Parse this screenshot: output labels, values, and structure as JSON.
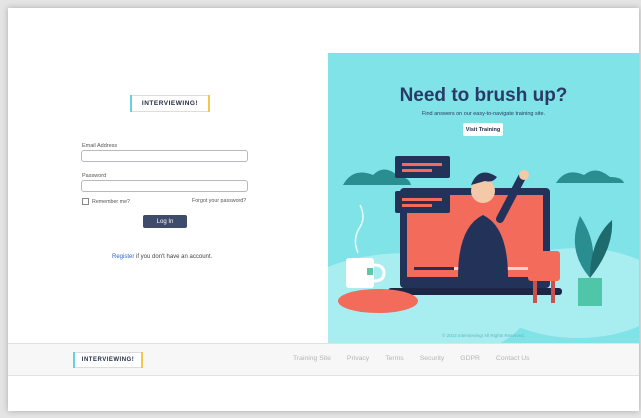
{
  "login": {
    "logo_text": "INTERVIEWING!",
    "email_label": "Email Address",
    "email_value": "",
    "password_label": "Password",
    "password_value": "",
    "remember_label": "Remember me?",
    "forgot_label": "Forgot your password?",
    "login_button": "Log In",
    "register_link": "Register",
    "register_text": " if you don't have an account."
  },
  "promo": {
    "title": "Need to brush up?",
    "subtitle": "Find answers on our easy-to-navigate training site.",
    "button": "Visit Training",
    "copyright": "© 2023 Interviewing! All Rights Reserved.",
    "colors": {
      "background": "#7fe3e8",
      "title": "#2a3a66",
      "accent": "#f26b5b"
    }
  },
  "footer": {
    "logo_text": "INTERVIEWING!",
    "links": [
      "Training Site",
      "Privacy",
      "Terms",
      "Security",
      "GDPR",
      "Contact Us"
    ]
  }
}
